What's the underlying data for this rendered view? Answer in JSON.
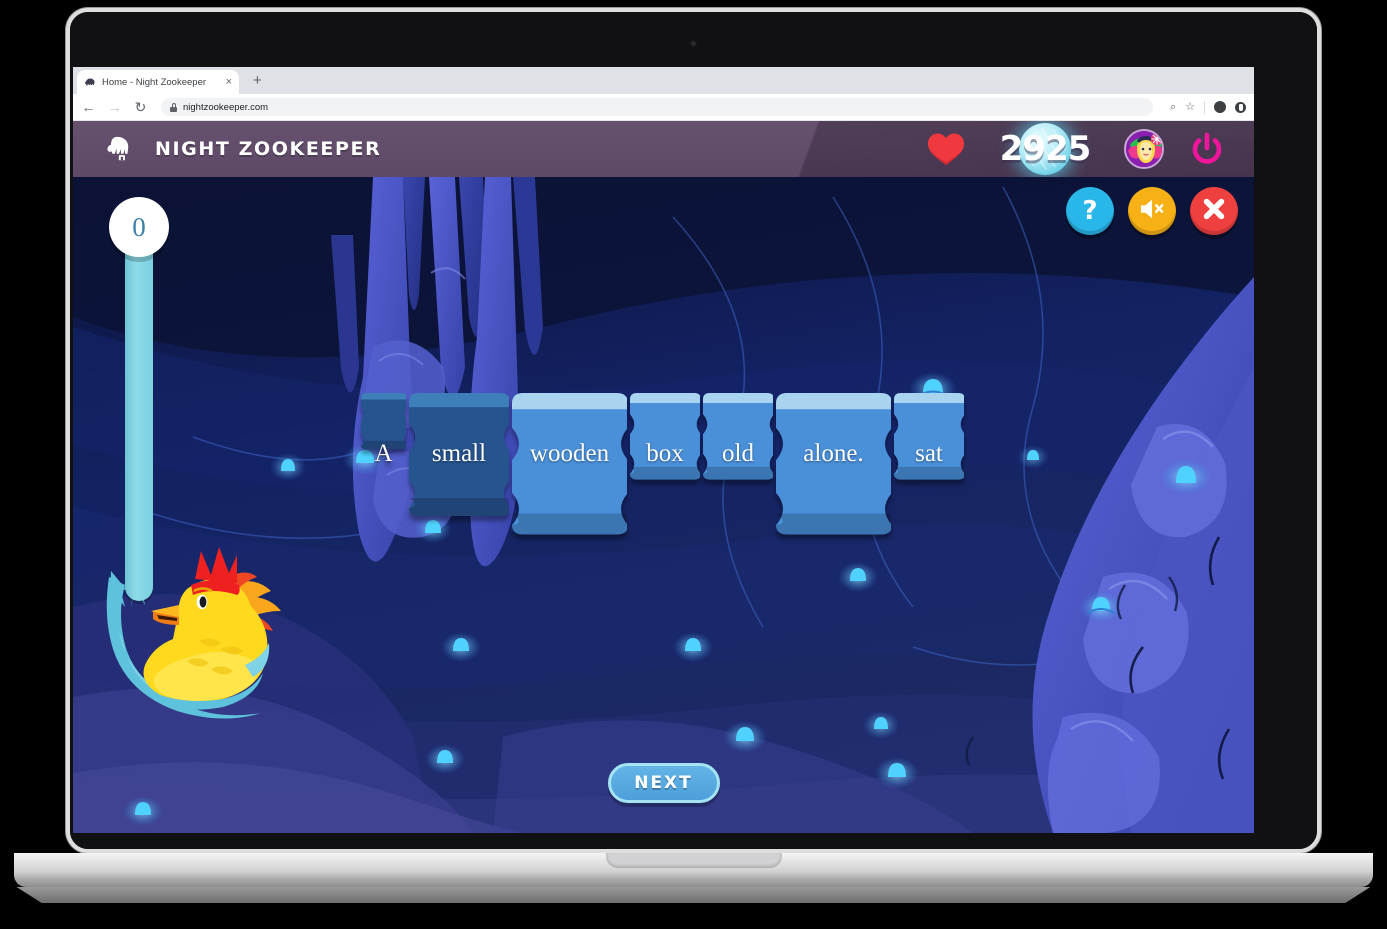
{
  "browser": {
    "tab": {
      "title": "Home - Night Zookeeper",
      "favicon": "mammoth-icon",
      "close": "×"
    },
    "new_tab": "+",
    "nav": {
      "back": "←",
      "forward": "→",
      "reload": "↻"
    },
    "address": {
      "url": "nightzookeeper.com",
      "lock": "lock-icon"
    },
    "toolbar_right": {
      "zoom": "⌕",
      "bookmark": "☆"
    }
  },
  "app": {
    "brand": "NIGHT ZOOKEEPER",
    "header": {
      "heart": "heart-icon",
      "score": "2925",
      "avatar": "user-avatar",
      "power": "power-icon"
    },
    "controls": {
      "help": "?",
      "sound": "sound-off-icon",
      "close": "close-icon"
    },
    "progress": {
      "value": "0"
    },
    "next_button": "NEXT"
  },
  "game": {
    "type": "sentence-builder",
    "tiles": [
      {
        "word": "A",
        "state": "placed"
      },
      {
        "word": "small",
        "state": "placed"
      },
      {
        "word": "wooden",
        "state": "available"
      },
      {
        "word": "box",
        "state": "available"
      },
      {
        "word": "old",
        "state": "available"
      },
      {
        "word": "alone.",
        "state": "available"
      },
      {
        "word": "sat",
        "state": "available"
      }
    ],
    "colors": {
      "tile_placed": "#26548f",
      "tile_placed_top": "#3d7fb8",
      "tile_available": "#4a90d9",
      "tile_available_top": "#a8d4f0",
      "header_purple": "#5e4867",
      "help_blue": "#29b6e8",
      "sound_orange": "#f7b117",
      "close_red": "#ef4040",
      "progress_cyan": "#8ddbe8",
      "power_magenta": "#f0169b",
      "heart_red": "#f0393e"
    }
  }
}
